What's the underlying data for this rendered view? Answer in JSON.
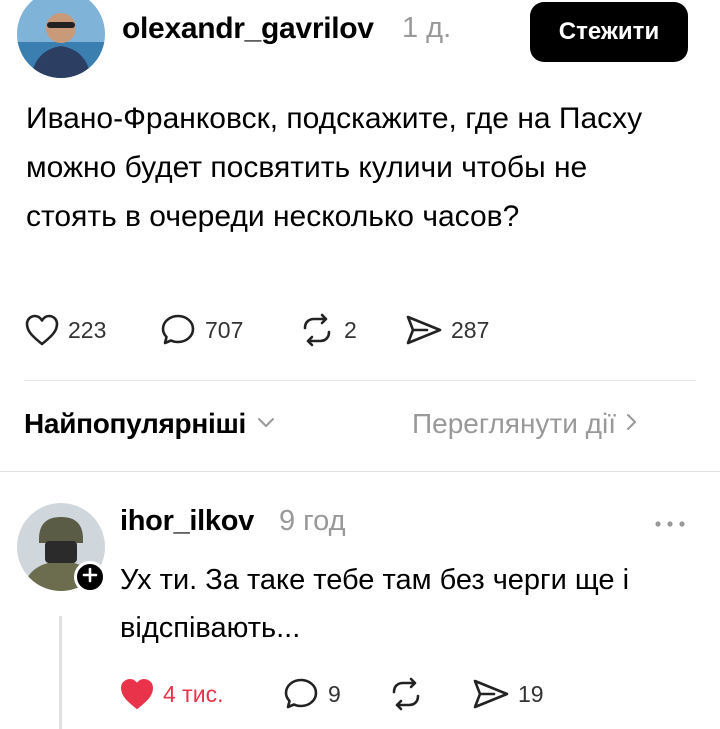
{
  "post": {
    "username": "olexandr_gavrilov",
    "time": "1 д.",
    "follow_label": "Стежити",
    "text": "Ивано-Франковск, подскажите, где на Пасху можно будет посвятить куличи чтобы не стоять в очереди несколько часов?",
    "likes": "223",
    "comments": "707",
    "reposts": "2",
    "shares": "287"
  },
  "sort_bar": {
    "sort_label": "Найпопулярніші",
    "view_activity_label": "Переглянути дії"
  },
  "reply": {
    "username": "ihor_ilkov",
    "time": "9 год",
    "text": "Ух ти. За таке тебе там без черги ще і відспівають...",
    "likes": "4 тис.",
    "comments": "9",
    "shares": "19"
  },
  "colors": {
    "liked_heart": "#e8334a",
    "muted_text": "#999999",
    "divider": "#e2e2e2"
  },
  "icons": [
    "heart-icon",
    "comment-icon",
    "repost-icon",
    "share-icon",
    "chevron-down-icon",
    "chevron-right-icon",
    "more-icon",
    "plus-icon"
  ]
}
